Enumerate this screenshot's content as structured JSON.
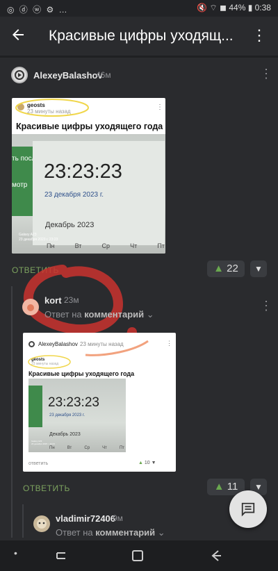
{
  "status": {
    "left": "◎ ⓓ ⓦ ⚙ …",
    "right": "🔇 ⌔ ◼ 44% ▮ 0:38"
  },
  "header": {
    "title": "Красивые цифры уходящ..."
  },
  "post1": {
    "author": "AlexeyBalashov",
    "time": "46м",
    "reply_label": "ОТВЕТИТЬ",
    "votes": "22",
    "image": {
      "src_author": "geosts",
      "src_time": "23 минуты назад",
      "heading": "Красивые цифры уходящего года",
      "clock": "23:23:23",
      "date": "23 декабря 2023 г.",
      "month": "Декабрь 2023",
      "weekdays": [
        "Пн",
        "Вт",
        "Ср",
        "Чт",
        "Пт"
      ],
      "side_text_1": "ть посл",
      "side_text_2": "мотр",
      "watermark": "Galaxy A23",
      "watermark2": "23 декабря 2023 г. 23:23"
    }
  },
  "post2": {
    "author": "kort",
    "time": "23м",
    "reply_to_prefix": "Ответ на ",
    "reply_to_word": "комментарий",
    "reply_label": "ОТВЕТИТЬ",
    "votes": "11",
    "image": {
      "author": "AlexeyBalashov",
      "time": "23 минуты назад",
      "src_author": "geosts",
      "src_time": "23 минуты назад",
      "heading": "Красивые цифры уходящего года",
      "clock": "23:23:23",
      "date": "23 декабря 2023 г.",
      "month": "Декабрь 2023",
      "weekdays": [
        "Пн",
        "Вт",
        "Ср",
        "Чт",
        "Пт"
      ],
      "reply_small": "ответить",
      "votes_small": "10",
      "watermark": "Galaxy A23",
      "watermark2": "23 декабря 2023 г. 23:23"
    }
  },
  "post3": {
    "author": "vladimir72406",
    "time": "9м",
    "reply_to_prefix": "Ответ на ",
    "reply_to_word": "комментарий"
  },
  "colors": {
    "accent": "#7da35f",
    "up": "#6aa84f",
    "background": "#2a2b2e"
  }
}
